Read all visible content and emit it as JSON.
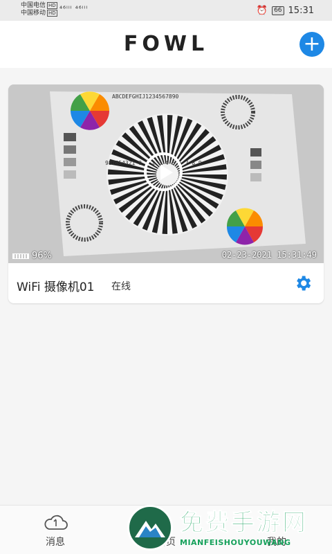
{
  "status_bar": {
    "carrier1": "中国电信",
    "carrier2": "中国移动",
    "hd_label": "HD",
    "signal": "⁴⁶ᴵᴵᴵ ⁴⁶ᴵᴵᴵ",
    "battery": "66",
    "time": "15:31"
  },
  "header": {
    "logo": "FOWL",
    "add_label": "+"
  },
  "device": {
    "battery": "96%",
    "timestamp": "02-23-2021 15:31:49",
    "name": "WiFi 摄像机01",
    "status": "在线",
    "chart_text_top": "ABCDEFGHIJ1234567890",
    "chart_text_mid": "987654321 0 1 2 3 4 5 6 7 8 9"
  },
  "nav": {
    "items": [
      {
        "label": "消息"
      },
      {
        "label": "首页"
      },
      {
        "label": "我的"
      }
    ]
  },
  "watermark": {
    "cn": "免费手游网",
    "en": "MIANFEISHOUYOUWANG"
  },
  "colors": {
    "accent": "#1e88e5",
    "watermark": "#16a15b"
  }
}
